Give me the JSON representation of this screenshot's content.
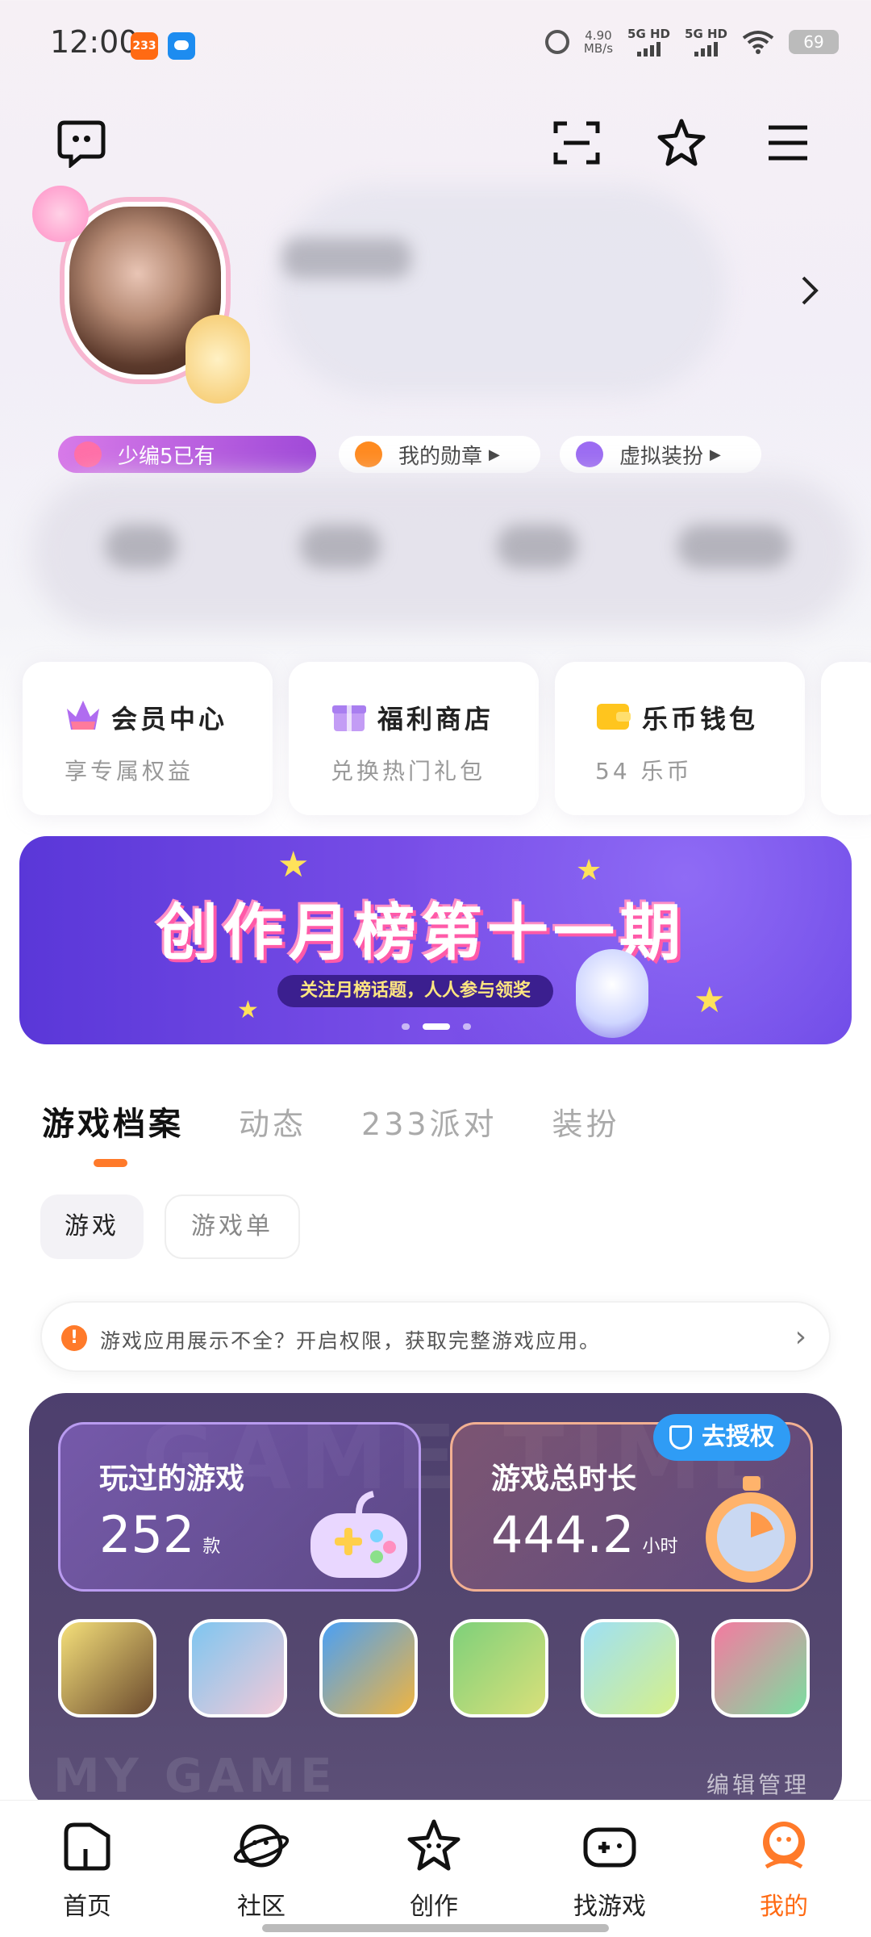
{
  "status_bar": {
    "time": "12:00",
    "app_badge": "233",
    "net_speed_value": "4.90",
    "net_speed_unit": "MB/s",
    "signal1": "5G HD",
    "signal2": "5G HD",
    "battery": "69"
  },
  "profile": {
    "chips": [
      {
        "label": "少编5已有",
        "color": "#b35ae0"
      },
      {
        "label": "我的勋章",
        "color": "#ff8a1f"
      },
      {
        "label": "虚拟装扮",
        "color": "#9c6cf2"
      }
    ]
  },
  "quick_cards": [
    {
      "title": "会员中心",
      "subtitle": "享专属权益"
    },
    {
      "title": "福利商店",
      "subtitle": "兑换热门礼包"
    },
    {
      "title": "乐币钱包",
      "subtitle": "54 乐币"
    }
  ],
  "banner": {
    "title": "创作月榜第十一期",
    "subtitle": "关注月榜话题，人人参与领奖"
  },
  "tabs": [
    "游戏档案",
    "动态",
    "233派对",
    "装扮"
  ],
  "filter_pills": [
    "游戏",
    "游戏单"
  ],
  "notice": {
    "text": "游戏应用展示不全？开启权限，获取完整游戏应用。"
  },
  "game_stats": {
    "bg_text": "GAME TIME",
    "played_label": "玩过的游戏",
    "played_value": "252",
    "played_unit": "款",
    "duration_label": "游戏总时长",
    "duration_value": "444.2",
    "duration_unit": "小时",
    "auth_label": "去授权",
    "my_game_text": "MY GAME",
    "edit_label": "编辑管理",
    "games": [
      {
        "name": "game-1",
        "colors": [
          "#f5e07a",
          "#6b4a2e"
        ]
      },
      {
        "name": "game-2",
        "colors": [
          "#7ec6f0",
          "#f3c9d8"
        ]
      },
      {
        "name": "game-3",
        "colors": [
          "#4aa0f5",
          "#f0b440"
        ]
      },
      {
        "name": "game-4",
        "colors": [
          "#7ed07a",
          "#d9e07a"
        ]
      },
      {
        "name": "game-5",
        "colors": [
          "#9ee0f5",
          "#d6f08a"
        ]
      },
      {
        "name": "game-6",
        "colors": [
          "#f57aa0",
          "#7adfa0"
        ]
      }
    ]
  },
  "bottom_nav": [
    {
      "label": "首页",
      "active": false
    },
    {
      "label": "社区",
      "active": false
    },
    {
      "label": "创作",
      "active": false
    },
    {
      "label": "找游戏",
      "active": false
    },
    {
      "label": "我的",
      "active": true
    }
  ],
  "colors": {
    "accent": "#ff7a2a",
    "banner_purple": "#6a45e4",
    "auth_blue": "#2f9cf5"
  }
}
